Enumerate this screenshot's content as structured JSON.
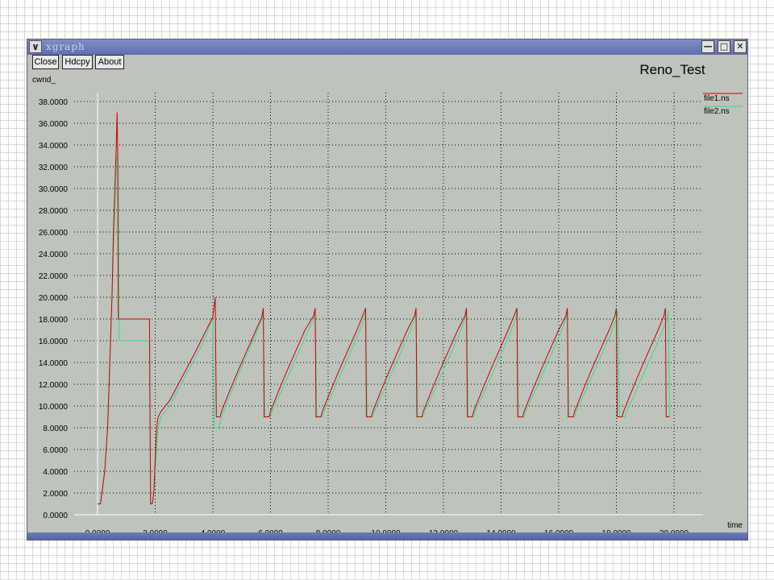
{
  "window": {
    "title": "xgraph",
    "menu_icon": "chevron-down-icon",
    "controls": [
      "minimize-icon",
      "maximize-icon",
      "close-icon"
    ]
  },
  "toolbar": {
    "close_label": "Close",
    "hdcpy_label": "Hdcpy",
    "about_label": "About"
  },
  "chart_data": {
    "type": "line",
    "title": "Reno_Test",
    "xlabel": "time",
    "ylabel": "cwnd_",
    "xlim": [
      0,
      21
    ],
    "ylim": [
      0,
      38
    ],
    "grid": true,
    "legend_position": "top-right",
    "x_ticks": [
      "0.0000",
      "2.0000",
      "4.0000",
      "6.0000",
      "8.0000",
      "10.0000",
      "12.0000",
      "14.0000",
      "16.0000",
      "18.0000",
      "20.0000"
    ],
    "y_ticks": [
      "0.0000",
      "2.0000",
      "4.0000",
      "6.0000",
      "8.0000",
      "10.0000",
      "12.0000",
      "14.0000",
      "16.0000",
      "18.0000",
      "20.0000",
      "22.0000",
      "24.0000",
      "26.0000",
      "28.0000",
      "30.0000",
      "32.0000",
      "34.0000",
      "36.0000",
      "38.0000"
    ],
    "series": [
      {
        "name": "file1.ns",
        "color": "#cc0000",
        "points": [
          [
            0,
            1
          ],
          [
            0.1,
            1
          ],
          [
            0.15,
            2
          ],
          [
            0.2,
            3
          ],
          [
            0.25,
            4
          ],
          [
            0.3,
            6
          ],
          [
            0.35,
            8
          ],
          [
            0.4,
            12
          ],
          [
            0.45,
            16
          ],
          [
            0.5,
            20
          ],
          [
            0.55,
            26
          ],
          [
            0.6,
            30
          ],
          [
            0.65,
            34
          ],
          [
            0.68,
            37
          ],
          [
            0.7,
            33
          ],
          [
            0.72,
            18
          ],
          [
            1.8,
            18
          ],
          [
            1.82,
            9
          ],
          [
            1.84,
            1
          ],
          [
            1.9,
            1
          ],
          [
            1.95,
            2
          ],
          [
            2.0,
            5
          ],
          [
            2.05,
            8
          ],
          [
            2.1,
            9
          ],
          [
            2.2,
            9.5
          ],
          [
            2.5,
            10.5
          ],
          [
            2.8,
            12
          ],
          [
            3.1,
            13.5
          ],
          [
            3.4,
            15
          ],
          [
            3.7,
            16.6
          ],
          [
            4.0,
            18.2
          ],
          [
            4.08,
            20
          ],
          [
            4.12,
            9
          ],
          [
            4.25,
            9
          ],
          [
            4.3,
            9.5
          ],
          [
            4.6,
            11.5
          ],
          [
            4.9,
            13.4
          ],
          [
            5.2,
            15.2
          ],
          [
            5.5,
            17
          ],
          [
            5.7,
            18.2
          ],
          [
            5.75,
            19
          ],
          [
            5.78,
            9
          ],
          [
            5.95,
            9
          ],
          [
            6.0,
            9.5
          ],
          [
            6.3,
            11.5
          ],
          [
            6.6,
            13.4
          ],
          [
            6.9,
            15.2
          ],
          [
            7.2,
            17
          ],
          [
            7.5,
            18.3
          ],
          [
            7.55,
            19
          ],
          [
            7.58,
            9
          ],
          [
            7.75,
            9
          ],
          [
            7.8,
            9.5
          ],
          [
            8.1,
            11.5
          ],
          [
            8.4,
            13.4
          ],
          [
            8.7,
            15.2
          ],
          [
            9.0,
            17
          ],
          [
            9.2,
            18.3
          ],
          [
            9.3,
            19
          ],
          [
            9.33,
            9
          ],
          [
            9.5,
            9
          ],
          [
            9.55,
            9.5
          ],
          [
            9.85,
            11.5
          ],
          [
            10.15,
            13.4
          ],
          [
            10.45,
            15.2
          ],
          [
            10.75,
            17
          ],
          [
            11.0,
            18.3
          ],
          [
            11.05,
            19
          ],
          [
            11.08,
            9
          ],
          [
            11.25,
            9
          ],
          [
            11.3,
            9.5
          ],
          [
            11.6,
            11.5
          ],
          [
            11.9,
            13.4
          ],
          [
            12.2,
            15.2
          ],
          [
            12.5,
            17
          ],
          [
            12.75,
            18.3
          ],
          [
            12.8,
            19
          ],
          [
            12.83,
            9
          ],
          [
            13.0,
            9
          ],
          [
            13.05,
            9.5
          ],
          [
            13.35,
            11.5
          ],
          [
            13.65,
            13.4
          ],
          [
            13.95,
            15.2
          ],
          [
            14.25,
            17
          ],
          [
            14.45,
            18.3
          ],
          [
            14.55,
            19
          ],
          [
            14.58,
            9
          ],
          [
            14.75,
            9
          ],
          [
            14.8,
            9.5
          ],
          [
            15.1,
            11.5
          ],
          [
            15.4,
            13.4
          ],
          [
            15.7,
            15.2
          ],
          [
            16.0,
            17
          ],
          [
            16.25,
            18.3
          ],
          [
            16.3,
            19
          ],
          [
            16.33,
            9
          ],
          [
            16.5,
            9
          ],
          [
            16.55,
            9.5
          ],
          [
            16.85,
            11.5
          ],
          [
            17.15,
            13.4
          ],
          [
            17.45,
            15.2
          ],
          [
            17.75,
            17
          ],
          [
            17.95,
            18.3
          ],
          [
            18.0,
            19
          ],
          [
            18.03,
            9
          ],
          [
            18.2,
            9
          ],
          [
            18.25,
            9.5
          ],
          [
            18.55,
            11.5
          ],
          [
            18.85,
            13.4
          ],
          [
            19.15,
            15.2
          ],
          [
            19.45,
            17
          ],
          [
            19.65,
            18.3
          ],
          [
            19.7,
            19
          ],
          [
            19.73,
            9
          ],
          [
            19.85,
            9
          ]
        ]
      },
      {
        "name": "file2.ns",
        "color": "#33dd88",
        "points": [
          [
            0,
            1
          ],
          [
            0.1,
            1
          ],
          [
            0.15,
            2
          ],
          [
            0.2,
            3
          ],
          [
            0.25,
            4
          ],
          [
            0.3,
            6
          ],
          [
            0.35,
            8
          ],
          [
            0.4,
            12
          ],
          [
            0.45,
            16
          ],
          [
            0.5,
            20
          ],
          [
            0.55,
            24
          ],
          [
            0.6,
            28
          ],
          [
            0.65,
            32
          ],
          [
            0.68,
            33
          ],
          [
            0.72,
            32
          ],
          [
            0.75,
            16
          ],
          [
            1.8,
            16
          ],
          [
            1.82,
            8
          ],
          [
            1.84,
            1
          ],
          [
            1.9,
            1
          ],
          [
            1.95,
            2
          ],
          [
            2.0,
            4
          ],
          [
            2.05,
            6
          ],
          [
            2.1,
            8
          ],
          [
            2.2,
            9
          ],
          [
            2.5,
            10
          ],
          [
            2.8,
            11.5
          ],
          [
            3.1,
            13
          ],
          [
            3.4,
            14.5
          ],
          [
            3.7,
            16
          ],
          [
            3.9,
            17.5
          ],
          [
            4.0,
            18
          ],
          [
            4.05,
            8
          ],
          [
            4.2,
            8
          ],
          [
            4.3,
            9
          ],
          [
            4.6,
            11
          ],
          [
            4.9,
            13
          ],
          [
            5.2,
            14.8
          ],
          [
            5.5,
            16.6
          ],
          [
            5.7,
            18
          ],
          [
            5.75,
            18.5
          ],
          [
            5.8,
            9
          ],
          [
            6.0,
            9
          ],
          [
            6.05,
            9.5
          ],
          [
            6.35,
            11.2
          ],
          [
            6.65,
            13
          ],
          [
            6.95,
            14.8
          ],
          [
            7.25,
            16.6
          ],
          [
            7.5,
            18
          ],
          [
            7.55,
            19
          ],
          [
            7.6,
            9
          ],
          [
            7.8,
            9
          ],
          [
            7.85,
            9.5
          ],
          [
            8.15,
            11.2
          ],
          [
            8.45,
            13
          ],
          [
            8.75,
            14.8
          ],
          [
            9.05,
            16.6
          ],
          [
            9.25,
            18
          ],
          [
            9.3,
            18.8
          ],
          [
            9.35,
            9
          ],
          [
            9.55,
            9
          ],
          [
            9.6,
            9.5
          ],
          [
            9.9,
            11.2
          ],
          [
            10.2,
            13
          ],
          [
            10.5,
            14.8
          ],
          [
            10.8,
            16.6
          ],
          [
            11.0,
            18
          ],
          [
            11.05,
            18.8
          ],
          [
            11.1,
            9
          ],
          [
            11.3,
            9
          ],
          [
            11.35,
            9.5
          ],
          [
            11.65,
            11.2
          ],
          [
            11.95,
            13
          ],
          [
            12.25,
            14.8
          ],
          [
            12.55,
            16.6
          ],
          [
            12.75,
            18
          ],
          [
            12.8,
            18.8
          ],
          [
            12.85,
            9
          ],
          [
            13.05,
            9
          ],
          [
            13.1,
            9.5
          ],
          [
            13.4,
            11.2
          ],
          [
            13.7,
            13
          ],
          [
            14.0,
            14.8
          ],
          [
            14.3,
            16.6
          ],
          [
            14.5,
            18
          ],
          [
            14.55,
            18.8
          ],
          [
            14.6,
            9
          ],
          [
            14.8,
            9
          ],
          [
            14.85,
            9.5
          ],
          [
            15.15,
            11.2
          ],
          [
            15.45,
            13
          ],
          [
            15.75,
            14.8
          ],
          [
            16.05,
            16.6
          ],
          [
            16.25,
            18
          ],
          [
            16.3,
            18.8
          ],
          [
            16.35,
            9
          ],
          [
            16.55,
            9
          ],
          [
            16.6,
            9.5
          ],
          [
            16.9,
            11.2
          ],
          [
            17.2,
            13
          ],
          [
            17.5,
            14.8
          ],
          [
            17.8,
            16.6
          ],
          [
            18.0,
            18
          ],
          [
            18.05,
            18.8
          ],
          [
            18.1,
            9
          ],
          [
            18.3,
            9
          ],
          [
            18.35,
            9.5
          ],
          [
            18.65,
            11.2
          ],
          [
            18.95,
            13
          ],
          [
            19.25,
            14.8
          ],
          [
            19.55,
            16.6
          ],
          [
            19.75,
            18
          ],
          [
            19.8,
            18.8
          ],
          [
            19.85,
            9
          ]
        ]
      }
    ]
  }
}
